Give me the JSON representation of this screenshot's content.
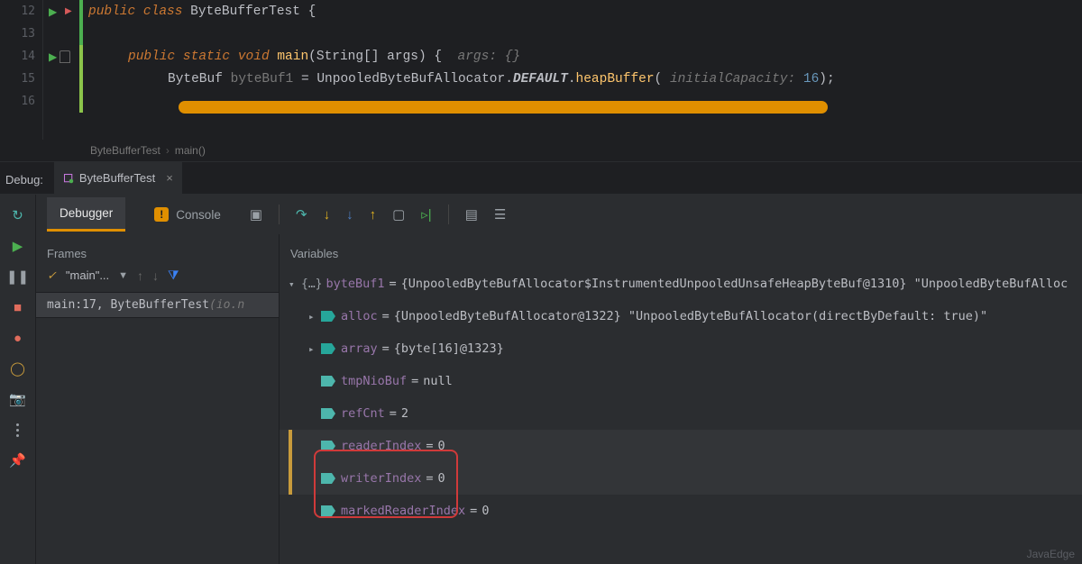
{
  "editor": {
    "lines": [
      "12",
      "13",
      "14",
      "15",
      "16"
    ],
    "class_kw": "public class ",
    "class_name": "ByteBufferTest",
    "open_brace": " {",
    "main_kw1": "public ",
    "main_kw2": "static ",
    "main_kw3": "void ",
    "main_name": "main",
    "main_params": "(String[] args) {",
    "main_hint": "  args: {}",
    "line15_type": "ByteBuf ",
    "line15_var": "byteBuf1",
    "line15_eq": " = ",
    "line15_alloc": "UnpooledByteBufAllocator",
    "line15_dot1": ".",
    "line15_default": "DEFAULT",
    "line15_dot2": ".",
    "line15_heap": "heapBuffer",
    "line15_open": "( ",
    "line15_hint": "initialCapacity: ",
    "line15_val": "16",
    "line15_close": ");"
  },
  "breadcrumb": {
    "a": "ByteBufferTest",
    "b": "main()"
  },
  "debugTabs": {
    "label": "Debug:",
    "tab": "ByteBufferTest"
  },
  "toolstrip": {
    "debugger": "Debugger",
    "console": "Console"
  },
  "frames": {
    "title": "Frames",
    "thread": "\"main\"...",
    "row": "main:17, ByteBufferTest ",
    "row_loc": "(io.n"
  },
  "variables": {
    "title": "Variables",
    "root": {
      "name": "byteBuf1",
      "val": "{UnpooledByteBufAllocator$InstrumentedUnpooledUnsafeHeapByteBuf@1310} \"UnpooledByteBufAlloc"
    },
    "alloc": {
      "name": "alloc",
      "val": "{UnpooledByteBufAllocator@1322} \"UnpooledByteBufAllocator(directByDefault: true)\""
    },
    "array": {
      "name": "array",
      "val": "{byte[16]@1323}"
    },
    "tmp": {
      "name": "tmpNioBuf",
      "val": "null"
    },
    "refCnt": {
      "name": "refCnt",
      "val": "2"
    },
    "reader": {
      "name": "readerIndex",
      "val": "0"
    },
    "writer": {
      "name": "writerIndex",
      "val": "0"
    },
    "marked": {
      "name": "markedReaderIndex",
      "val": "0"
    }
  },
  "watermark": "JavaEdge"
}
